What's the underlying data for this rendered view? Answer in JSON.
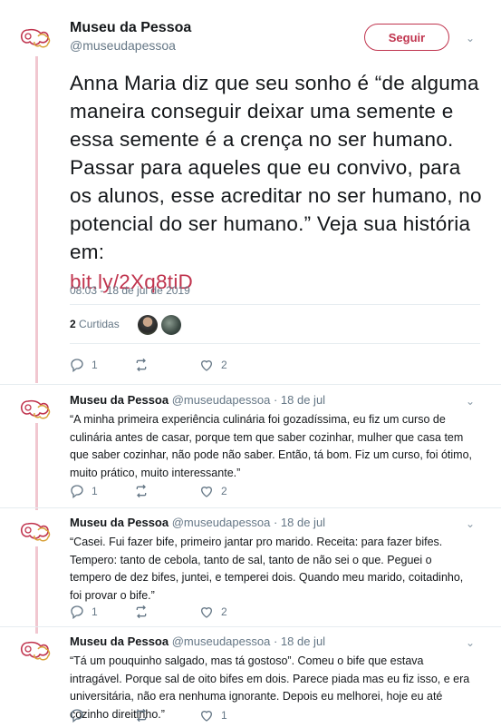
{
  "main_tweet": {
    "display_name": "Museu da Pessoa",
    "handle": "@museudapessoa",
    "follow_label": "Seguir",
    "text": "Anna Maria diz que seu sonho é “de alguma maneira conseguir deixar uma semente e essa semente é a crença no ser humano. Passar para aqueles que eu convivo, para os alunos, esse acreditar no ser humano, no potencial do ser humano.” Veja sua história em:",
    "link": "bit.ly/2Xq8tiD",
    "timestamp": "08:03 - 18 de jul de 2019",
    "retweet_count": "2",
    "retweet_label": "Curtidas",
    "actions": {
      "reply": "1",
      "retweet": "",
      "like": "2"
    }
  },
  "replies": [
    {
      "display_name": "Museu da Pessoa",
      "handle": "@museudapessoa",
      "date": "· 18 de jul",
      "text": "“A minha primeira experiência culinária foi gozadíssima, eu fiz um curso de culinária antes de casar, porque tem que saber cozinhar, mulher que casa tem que saber cozinhar, não pode não saber. Então, tá bom. Fiz um curso, foi ótimo, muito prático, muito interessante.”",
      "actions": {
        "reply": "1",
        "retweet": "",
        "like": "2"
      }
    },
    {
      "display_name": "Museu da Pessoa",
      "handle": "@museudapessoa",
      "date": "· 18 de jul",
      "text": "“Casei. Fui fazer bife, primeiro jantar pro marido. Receita: para fazer bifes. Tempero: tanto de cebola, tanto de sal, tanto de não sei o que. Peguei o tempero de dez bifes, juntei, e temperei dois. Quando meu marido, coitadinho, foi provar o bife.”",
      "actions": {
        "reply": "1",
        "retweet": "",
        "like": "2"
      }
    },
    {
      "display_name": "Museu da Pessoa",
      "handle": "@museudapessoa",
      "date": "· 18 de jul",
      "text": "“Tá um pouquinho salgado, mas tá gostoso”. Comeu o bife que estava intragável. Porque sal de oito bifes em dois. Parece piada mas eu fiz isso, e era universitária, não era nenhuma ignorante. Depois eu melhorei, hoje eu até cozinho direitinho.”",
      "actions": {
        "reply": "",
        "retweet": "",
        "like": "1"
      }
    }
  ],
  "colors": {
    "brand": "#c0344e",
    "thread": "#f1c7d0",
    "meta": "#657786"
  }
}
